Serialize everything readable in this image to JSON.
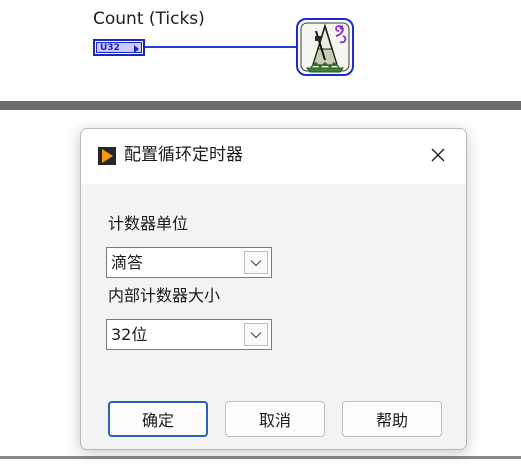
{
  "block_diagram": {
    "terminal_label": "Count (Ticks)",
    "terminal_type": "U32",
    "timer_node_icon": "metronome-timer-icon",
    "colors": {
      "wire": "#2a3ad6",
      "terminal_border": "#1a24c8",
      "terminal_fill": "#c9cbff"
    }
  },
  "dialog": {
    "title": "配置循环定时器",
    "title_icon": "labview-play-icon",
    "close_icon": "close-icon",
    "fields": [
      {
        "label": "计数器单位",
        "selected_value": "滴答"
      },
      {
        "label": "内部计数器大小",
        "selected_value": "32位"
      }
    ],
    "buttons": {
      "ok_label": "确定",
      "cancel_label": "取消",
      "help_label": "帮助"
    },
    "colors": {
      "default_button_border": "#2a62b8",
      "icon_orange": "#f39c12"
    }
  }
}
